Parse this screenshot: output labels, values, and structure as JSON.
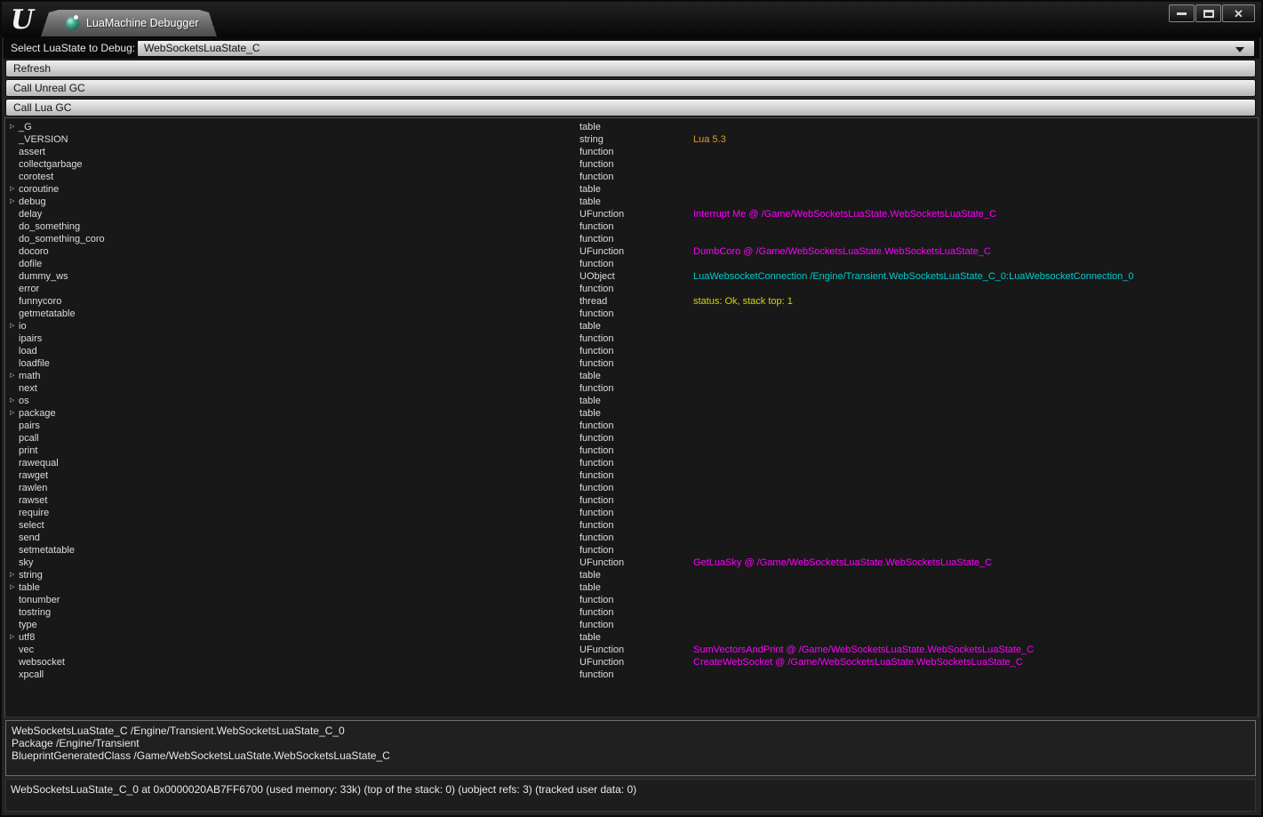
{
  "tab_bar": {
    "tab": {
      "icon": "luamachine-icon",
      "label": "LuaMachine Debugger",
      "close_label": "×"
    }
  },
  "window_controls": {
    "minimize": "",
    "maximize": "",
    "close": "✕"
  },
  "state_selector": {
    "label": "Select LuaState to Debug:",
    "value": "WebSocketsLuaState_C"
  },
  "toolbar": {
    "buttons": [
      "Refresh",
      "Call Unreal GC",
      "Call Lua GC"
    ]
  },
  "colors": {
    "orange": "#E8991F",
    "magenta": "#FF00FF",
    "cyan": "#00CCCC",
    "yellow": "#D6D600"
  },
  "tree": {
    "rows": [
      {
        "name": "_G",
        "type": "table",
        "value": "",
        "color": "",
        "expandable": true
      },
      {
        "name": "_VERSION",
        "type": "string",
        "value": "Lua 5.3",
        "color": "orange",
        "expandable": false
      },
      {
        "name": "assert",
        "type": "function",
        "value": "",
        "color": "",
        "expandable": false
      },
      {
        "name": "collectgarbage",
        "type": "function",
        "value": "",
        "color": "",
        "expandable": false
      },
      {
        "name": "corotest",
        "type": "function",
        "value": "",
        "color": "",
        "expandable": false
      },
      {
        "name": "coroutine",
        "type": "table",
        "value": "",
        "color": "",
        "expandable": true
      },
      {
        "name": "debug",
        "type": "table",
        "value": "",
        "color": "",
        "expandable": true
      },
      {
        "name": "delay",
        "type": "UFunction",
        "value": "Interrupt Me @ /Game/WebSocketsLuaState.WebSocketsLuaState_C",
        "color": "magenta",
        "expandable": false
      },
      {
        "name": "do_something",
        "type": "function",
        "value": "",
        "color": "",
        "expandable": false
      },
      {
        "name": "do_something_coro",
        "type": "function",
        "value": "",
        "color": "",
        "expandable": false
      },
      {
        "name": "docoro",
        "type": "UFunction",
        "value": "DumbCoro @ /Game/WebSocketsLuaState.WebSocketsLuaState_C",
        "color": "magenta",
        "expandable": false
      },
      {
        "name": "dofile",
        "type": "function",
        "value": "",
        "color": "",
        "expandable": false
      },
      {
        "name": "dummy_ws",
        "type": "UObject",
        "value": "LuaWebsocketConnection /Engine/Transient.WebSocketsLuaState_C_0:LuaWebsocketConnection_0",
        "color": "cyan",
        "expandable": false
      },
      {
        "name": "error",
        "type": "function",
        "value": "",
        "color": "",
        "expandable": false
      },
      {
        "name": "funnycoro",
        "type": "thread",
        "value": "status: Ok, stack top: 1",
        "color": "yellow",
        "expandable": false
      },
      {
        "name": "getmetatable",
        "type": "function",
        "value": "",
        "color": "",
        "expandable": false
      },
      {
        "name": "io",
        "type": "table",
        "value": "",
        "color": "",
        "expandable": true
      },
      {
        "name": "ipairs",
        "type": "function",
        "value": "",
        "color": "",
        "expandable": false
      },
      {
        "name": "load",
        "type": "function",
        "value": "",
        "color": "",
        "expandable": false
      },
      {
        "name": "loadfile",
        "type": "function",
        "value": "",
        "color": "",
        "expandable": false
      },
      {
        "name": "math",
        "type": "table",
        "value": "",
        "color": "",
        "expandable": true
      },
      {
        "name": "next",
        "type": "function",
        "value": "",
        "color": "",
        "expandable": false
      },
      {
        "name": "os",
        "type": "table",
        "value": "",
        "color": "",
        "expandable": true
      },
      {
        "name": "package",
        "type": "table",
        "value": "",
        "color": "",
        "expandable": true
      },
      {
        "name": "pairs",
        "type": "function",
        "value": "",
        "color": "",
        "expandable": false
      },
      {
        "name": "pcall",
        "type": "function",
        "value": "",
        "color": "",
        "expandable": false
      },
      {
        "name": "print",
        "type": "function",
        "value": "",
        "color": "",
        "expandable": false
      },
      {
        "name": "rawequal",
        "type": "function",
        "value": "",
        "color": "",
        "expandable": false
      },
      {
        "name": "rawget",
        "type": "function",
        "value": "",
        "color": "",
        "expandable": false
      },
      {
        "name": "rawlen",
        "type": "function",
        "value": "",
        "color": "",
        "expandable": false
      },
      {
        "name": "rawset",
        "type": "function",
        "value": "",
        "color": "",
        "expandable": false
      },
      {
        "name": "require",
        "type": "function",
        "value": "",
        "color": "",
        "expandable": false
      },
      {
        "name": "select",
        "type": "function",
        "value": "",
        "color": "",
        "expandable": false
      },
      {
        "name": "send",
        "type": "function",
        "value": "",
        "color": "",
        "expandable": false
      },
      {
        "name": "setmetatable",
        "type": "function",
        "value": "",
        "color": "",
        "expandable": false
      },
      {
        "name": "sky",
        "type": "UFunction",
        "value": "GetLuaSky @ /Game/WebSocketsLuaState.WebSocketsLuaState_C",
        "color": "magenta",
        "expandable": false
      },
      {
        "name": "string",
        "type": "table",
        "value": "",
        "color": "",
        "expandable": true
      },
      {
        "name": "table",
        "type": "table",
        "value": "",
        "color": "",
        "expandable": true
      },
      {
        "name": "tonumber",
        "type": "function",
        "value": "",
        "color": "",
        "expandable": false
      },
      {
        "name": "tostring",
        "type": "function",
        "value": "",
        "color": "",
        "expandable": false
      },
      {
        "name": "type",
        "type": "function",
        "value": "",
        "color": "",
        "expandable": false
      },
      {
        "name": "utf8",
        "type": "table",
        "value": "",
        "color": "",
        "expandable": true
      },
      {
        "name": "vec",
        "type": "UFunction",
        "value": "SumVectorsAndPrint @ /Game/WebSocketsLuaState.WebSocketsLuaState_C",
        "color": "magenta",
        "expandable": false
      },
      {
        "name": "websocket",
        "type": "UFunction",
        "value": "CreateWebSocket @ /Game/WebSocketsLuaState.WebSocketsLuaState_C",
        "color": "magenta",
        "expandable": false
      },
      {
        "name": "xpcall",
        "type": "function",
        "value": "",
        "color": "",
        "expandable": false
      }
    ]
  },
  "info_box": {
    "lines": [
      "WebSocketsLuaState_C /Engine/Transient.WebSocketsLuaState_C_0",
      "Package /Engine/Transient",
      "BlueprintGeneratedClass /Game/WebSocketsLuaState.WebSocketsLuaState_C"
    ]
  },
  "status_bar": {
    "text": "WebSocketsLuaState_C_0 at 0x0000020AB7FF6700 (used memory: 33k) (top of the stack: 0) (uobject refs: 3) (tracked user data: 0)"
  }
}
